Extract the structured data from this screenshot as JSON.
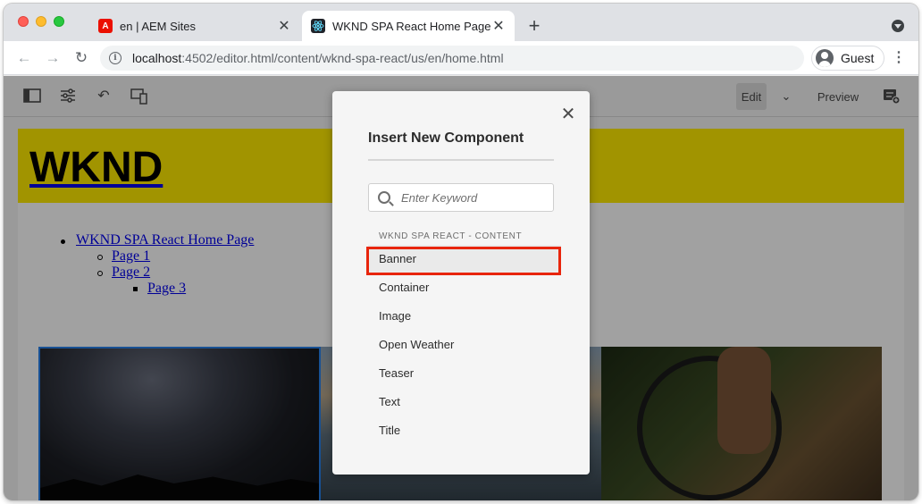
{
  "browser": {
    "tabs": [
      {
        "title": "en | AEM Sites",
        "favicon": "adobe-icon",
        "active": false
      },
      {
        "title": "WKND SPA React Home Page",
        "favicon": "react-icon",
        "active": true
      }
    ],
    "new_tab_label": "+",
    "url_host": "localhost",
    "url_path": ":4502/editor.html/content/wknd-spa-react/us/en/home.html",
    "profile_name": "Guest"
  },
  "editor": {
    "toolbar_icons": [
      "side-panel-icon",
      "page-properties-icon",
      "undo-icon",
      "emulator-icon"
    ],
    "edit_label": "Edit",
    "preview_label": "Preview",
    "annotate_icon": "annotate-icon"
  },
  "page": {
    "logo": "WKND",
    "nav": [
      {
        "label": "WKND SPA React Home Page",
        "level": 1
      },
      {
        "label": "Page 1",
        "level": 2
      },
      {
        "label": "Page 2",
        "level": 2
      },
      {
        "label": "Page 3",
        "level": 3
      }
    ],
    "carousel": [
      "night-sky-image",
      "lake-image",
      "mountain-bike-image"
    ]
  },
  "dialog": {
    "title": "Insert New Component",
    "search_placeholder": "Enter Keyword",
    "group": "WKND SPA REACT - CONTENT",
    "components": [
      "Banner",
      "Container",
      "Image",
      "Open Weather",
      "Teaser",
      "Text",
      "Title"
    ],
    "highlighted": "Banner",
    "highlight_color": "#e8250c"
  },
  "colors": {
    "wknd_yellow": "#ffea00",
    "link_blue": "#0000ee",
    "selection_blue": "#2680eb"
  }
}
